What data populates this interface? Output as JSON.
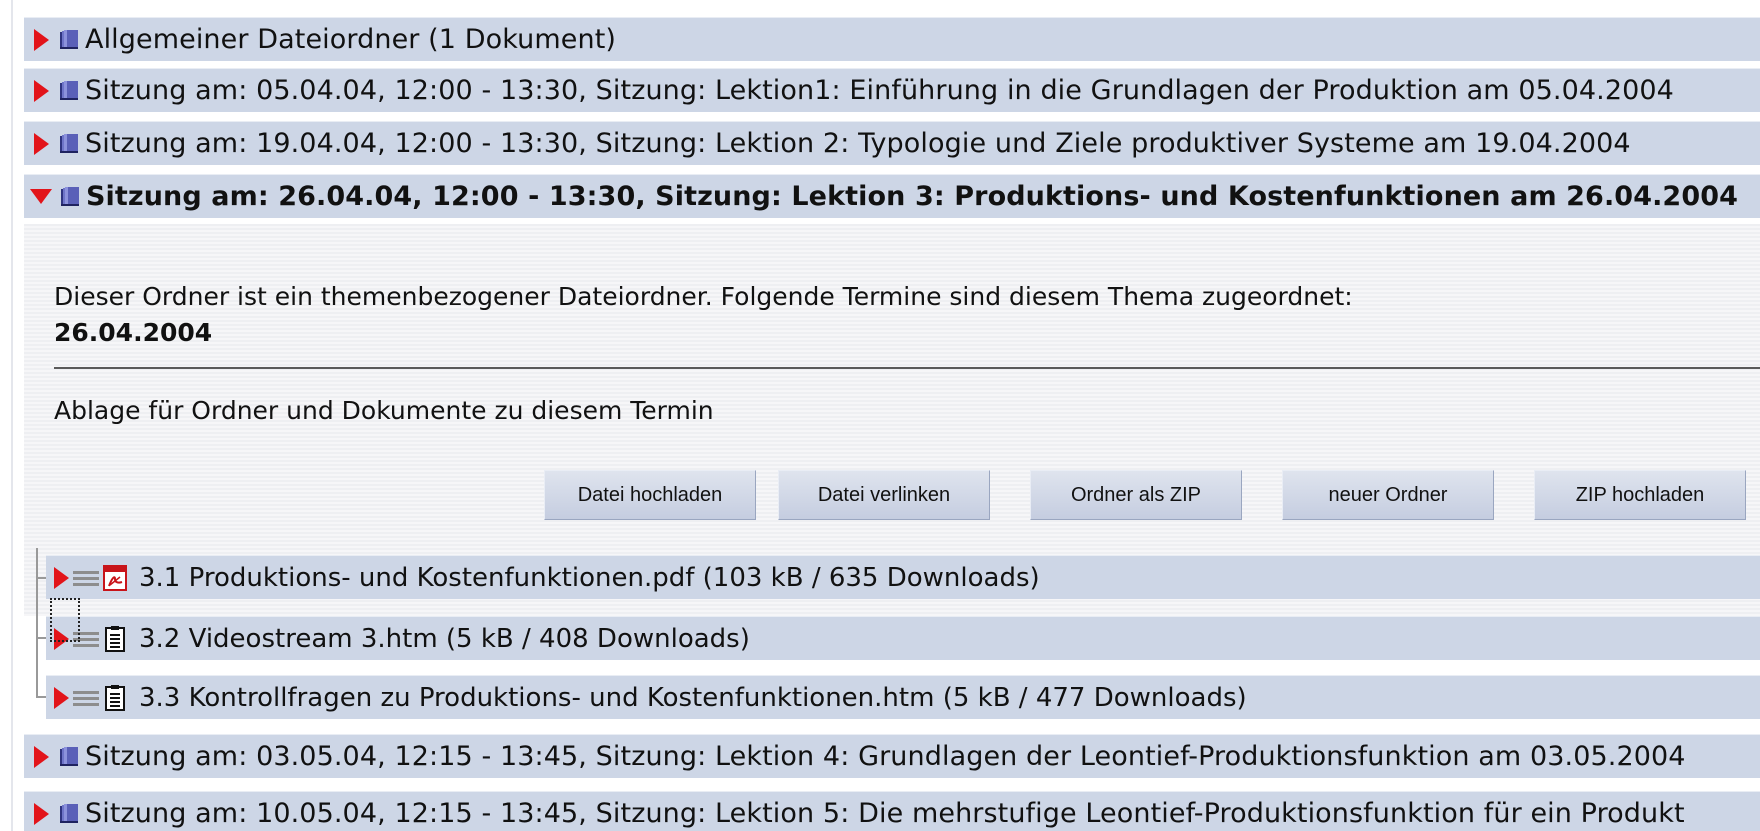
{
  "folders_top": [
    {
      "label": "Allgemeiner Dateiordner  (1 Dokument)"
    },
    {
      "label": "Sitzung am: 05.04.04, 12:00 - 13:30, Sitzung: Lektion1: Einführung in die Grundlagen der Produktion am 05.04.2004"
    },
    {
      "label": "Sitzung am: 19.04.04, 12:00 - 13:30, Sitzung: Lektion 2: Typologie und Ziele produktiver Systeme am 19.04.2004"
    }
  ],
  "open_folder": {
    "label": "Sitzung am: 26.04.04, 12:00 - 13:30, Sitzung: Lektion 3: Produktions- und Kostenfunktionen am 26.04.2004",
    "description": "Dieser Ordner ist ein themenbezogener Dateiordner. Folgende Termine sind diesem Thema zugeordnet:",
    "date": "26.04.2004",
    "storage_text": "Ablage für Ordner und Dokumente zu diesem Termin",
    "buttons": {
      "upload": "Datei hochladen",
      "link": "Datei verlinken",
      "zip_folder": "Ordner als ZIP",
      "new_folder": "neuer Ordner",
      "zip_upload": "ZIP hochladen"
    },
    "files": [
      {
        "label": "3.1 Produktions- und Kostenfunktionen.pdf  (103 kB / 635 Downloads)",
        "icon": "pdf-icon"
      },
      {
        "label": "3.2 Videostream 3.htm  (5 kB / 408 Downloads)",
        "icon": "document-icon"
      },
      {
        "label": "3.3 Kontrollfragen zu Produktions- und Kostenfunktionen.htm  (5 kB / 477 Downloads)",
        "icon": "document-icon"
      }
    ]
  },
  "folders_bottom": [
    {
      "label": "Sitzung am: 03.05.04, 12:15 - 13:45, Sitzung: Lektion 4: Grundlagen der Leontief-Produktionsfunktion am 03.05.2004"
    },
    {
      "label": "Sitzung am: 10.05.04, 12:15 - 13:45, Sitzung: Lektion 5: Die mehrstufige Leontief-Produktionsfunktion für ein Produkt"
    }
  ],
  "colors": {
    "row_bg": "#cdd6e6",
    "arrow": "#e2141a",
    "folder_icon": "#4a4fa8"
  }
}
